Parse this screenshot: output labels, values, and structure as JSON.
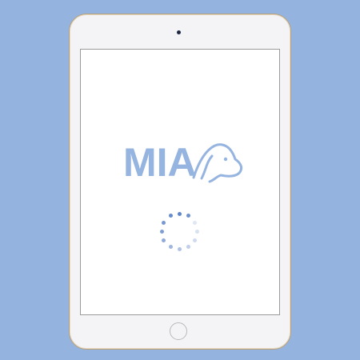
{
  "app": {
    "logo_text": "MIA",
    "brand_color": "#96b4e0",
    "logo_icon": "dog-head-icon"
  },
  "loading": {
    "icon": "loading-spinner",
    "dot_count": 12
  }
}
